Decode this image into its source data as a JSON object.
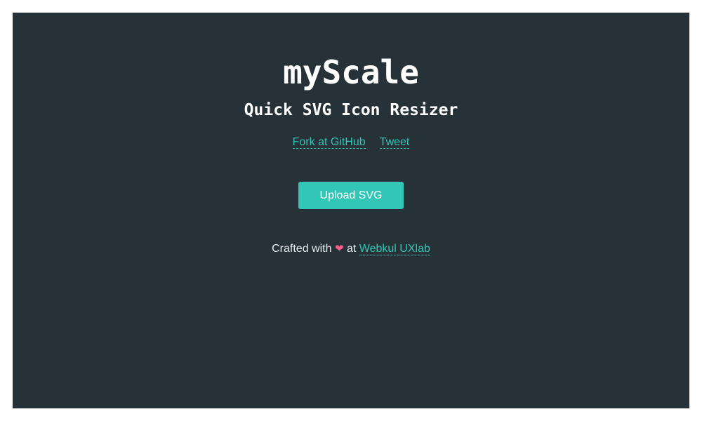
{
  "header": {
    "title": "myScale",
    "subtitle": "Quick SVG Icon Resizer"
  },
  "links": {
    "github": "Fork at GitHub",
    "tweet": "Tweet"
  },
  "upload": {
    "label": "Upload SVG"
  },
  "footer": {
    "crafted_text": "Crafted with",
    "heart": "❤",
    "at_text": "at",
    "author_link": "Webkul UXlab"
  },
  "colors": {
    "background": "#263238",
    "accent": "#31c6b5",
    "heart": "#ef5f86"
  }
}
